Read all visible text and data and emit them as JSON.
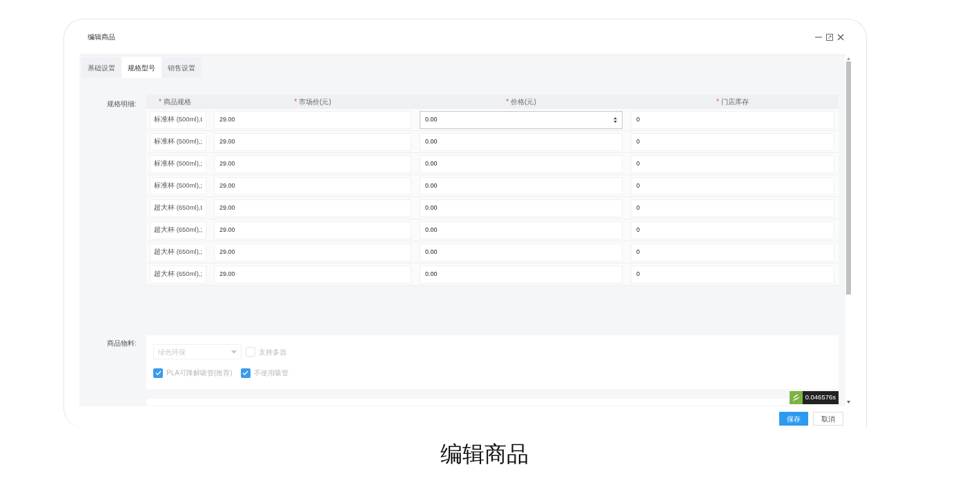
{
  "dialog": {
    "title": "编辑商品"
  },
  "tabs": [
    {
      "label": "基础设置",
      "selected": false
    },
    {
      "label": "规格型号",
      "selected": true
    },
    {
      "label": "销售设置",
      "selected": false
    }
  ],
  "spec_table": {
    "label": "规格明细:",
    "columns": [
      {
        "label": "商品规格",
        "required_mark": "*"
      },
      {
        "label": "市场价(元)",
        "required_mark": "*"
      },
      {
        "label": "价格(元)",
        "required_mark": "*"
      },
      {
        "label": "门店库存",
        "required_mark": "*"
      }
    ],
    "rows": [
      {
        "spec": "标准杯 (500ml),t",
        "market_price": "29.00",
        "price": "0.00",
        "stock": "0",
        "focused": true
      },
      {
        "spec": "标准杯 (500ml),;",
        "market_price": "29.00",
        "price": "0.00",
        "stock": "0",
        "focused": false
      },
      {
        "spec": "标准杯 (500ml),;",
        "market_price": "29.00",
        "price": "0.00",
        "stock": "0",
        "focused": false
      },
      {
        "spec": "标准杯 (500ml),;",
        "market_price": "29.00",
        "price": "0.00",
        "stock": "0",
        "focused": false
      },
      {
        "spec": "超大杯 (650ml),t",
        "market_price": "29.00",
        "price": "0.00",
        "stock": "0",
        "focused": false
      },
      {
        "spec": "超大杯 (650ml),;",
        "market_price": "29.00",
        "price": "0.00",
        "stock": "0",
        "focused": false
      },
      {
        "spec": "超大杯 (650ml),;",
        "market_price": "29.00",
        "price": "0.00",
        "stock": "0",
        "focused": false
      },
      {
        "spec": "超大杯 (650ml),;",
        "market_price": "29.00",
        "price": "0.00",
        "stock": "0",
        "focused": false
      }
    ]
  },
  "materials": {
    "label": "商品物料:",
    "select": {
      "placeholder": "绿色环保",
      "disabled": true
    },
    "options": [
      {
        "label": "支持多选",
        "checked": false,
        "disabled": true
      },
      {
        "label": "PLA可降解吸管(推荐)",
        "checked": true,
        "disabled": true
      },
      {
        "label": "不使用吸管",
        "checked": true,
        "disabled": true
      }
    ]
  },
  "timer": {
    "text": "0.046576s"
  },
  "buttons": [
    {
      "label": "保存",
      "kind": "primary"
    },
    {
      "label": "取消",
      "kind": "secondary"
    }
  ],
  "caption": "编辑商品"
}
